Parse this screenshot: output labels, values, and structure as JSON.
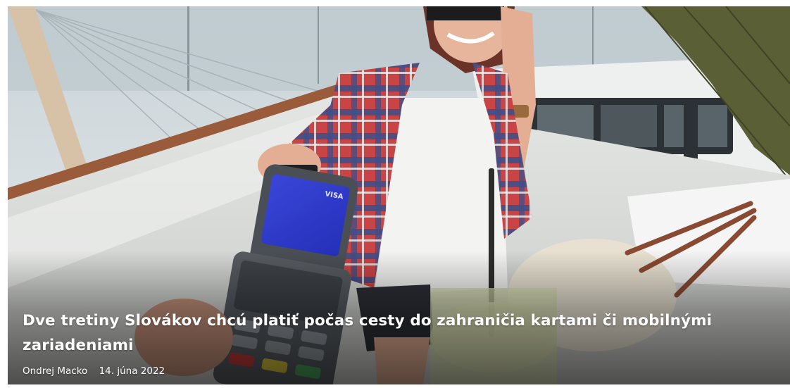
{
  "article": {
    "title": "Dve tretiny Slovákov chcú platiť počas cesty do zahraničia kartami či mobilnými zariadeniami",
    "author": "Ondrej Macko",
    "date": "14. júna 2022"
  },
  "image": {
    "alt": "",
    "terminal_brand": "VISA"
  },
  "colors": {
    "text": "#ffffff",
    "terminal_screen": "#2a36c8",
    "shirt_red": "#c23a3a",
    "shirt_blue": "#3d4f86"
  }
}
